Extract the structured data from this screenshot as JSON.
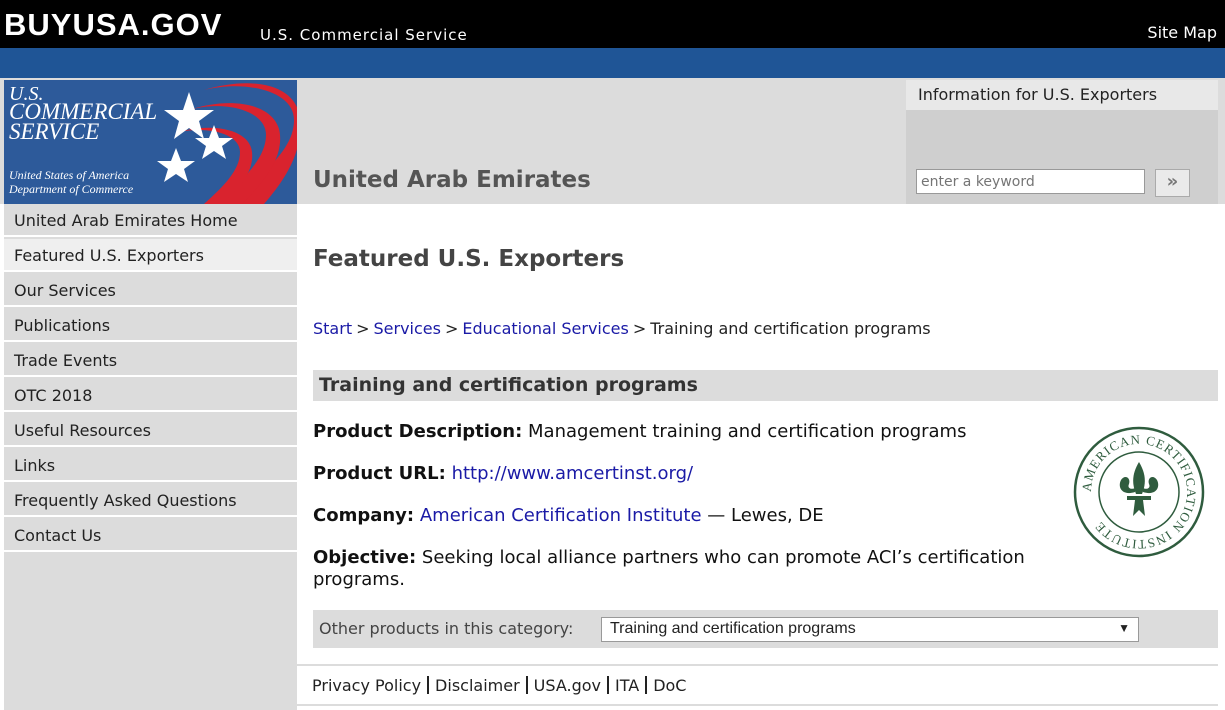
{
  "topbar": {
    "logo": "BUYUSA.GOV",
    "tagline": "U.S. Commercial Service",
    "site_map": "Site Map"
  },
  "header": {
    "cs_logo_lines": [
      "U.S.",
      "COMMERCIAL",
      "SERVICE",
      "United States of America",
      "Department of Commerce"
    ],
    "country": "United Arab Emirates",
    "info_tab": "Information for U.S. Exporters",
    "search_placeholder": "enter a keyword",
    "search_button": "»"
  },
  "sidebar": {
    "items": [
      {
        "label": "United Arab Emirates Home"
      },
      {
        "label": "Featured U.S. Exporters",
        "active": true
      },
      {
        "label": "Our Services"
      },
      {
        "label": "Publications"
      },
      {
        "label": "Trade Events"
      },
      {
        "label": "OTC 2018"
      },
      {
        "label": "Useful Resources"
      },
      {
        "label": "Links"
      },
      {
        "label": "Frequently Asked Questions"
      },
      {
        "label": "Contact Us"
      }
    ]
  },
  "main": {
    "title": "Featured U.S. Exporters",
    "breadcrumb": {
      "start": "Start",
      "services": "Services",
      "educational": "Educational Services",
      "current": "Training and certification programs"
    },
    "section_title": "Training and certification programs",
    "fields": {
      "desc_label": "Product Description:",
      "desc_value": "Management training and certification programs",
      "url_label": "Product URL:",
      "url_value": "http://www.amcertinst.org/",
      "company_label": "Company:",
      "company_value": "American Certification Institute",
      "company_location": "— Lewes, DE",
      "objective_label": "Objective:",
      "objective_value": "Seeking local alliance partners who can promote ACI’s certification programs."
    },
    "seal_text": "AMERICAN CERTIFICATION INSTITUTE",
    "other_products_label": "Other products in this category:",
    "other_products_selected": "Training and certification programs"
  },
  "footer": {
    "links": [
      "Privacy Policy",
      "Disclaimer",
      "USA.gov",
      "ITA",
      "DoC"
    ]
  },
  "colors": {
    "topbar": "#000000",
    "bluebar": "#1f5596",
    "panel_gray": "#dcdcdc",
    "link": "#1a1aa6",
    "seal_green": "#2f5c3e"
  }
}
